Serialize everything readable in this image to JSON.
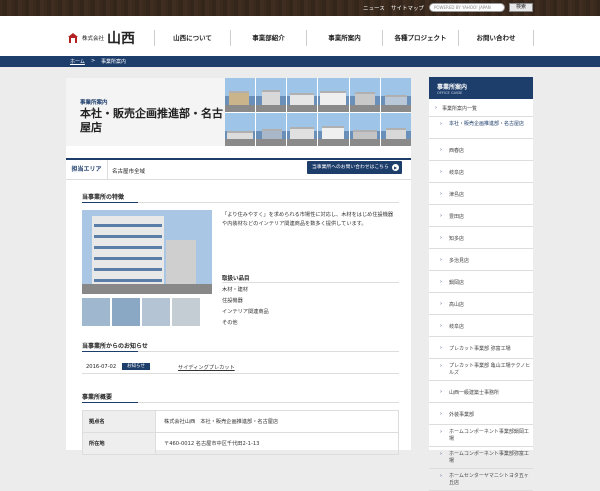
{
  "topbar": {
    "links": [
      "ニュース",
      "サイトマップ"
    ],
    "search_placeholder": "POWERED BY YAHOO! JAPAN",
    "search_button": "検索"
  },
  "header": {
    "logo_small": "株式会社",
    "logo_big": "山西",
    "nav": [
      "山西について",
      "事業部紹介",
      "事業所案内",
      "各種プロジェクト",
      "お問い合わせ"
    ]
  },
  "breadcrumb": [
    "ホーム",
    ">",
    "事業所案内"
  ],
  "hero": {
    "subtitle": "事業所案内",
    "title": "本社・販売企画推進部・名古屋店"
  },
  "area": {
    "label": "担当エリア",
    "value": "名古屋市全域",
    "inquiry_button": "当事業所へのお問い合わせはこちら"
  },
  "features": {
    "heading": "当事業所の特徴",
    "description": "「より住みやすく」を求められる市場性に対応し、木材をはじめ住設機器や内装材などのインテリア関連商品を数多く提供しています。",
    "items_heading": "取扱い品目",
    "items": [
      "木材・建材",
      "住設機器",
      "インテリア関連商品",
      "その他"
    ]
  },
  "news": {
    "heading": "当事業所からのお知らせ",
    "entries": [
      {
        "date": "2016-07-02",
        "badge": "お知らせ",
        "title": "サイディングプレカット"
      }
    ]
  },
  "overview": {
    "heading": "事業所概要",
    "rows": [
      {
        "label": "拠点名",
        "value": "株式会社山西　本社・販売企画推進部・名古屋店"
      },
      {
        "label": "所在地",
        "value": "〒460-0012 名古屋市中区千代田2-1-13"
      }
    ]
  },
  "sidebar": {
    "title": "事業所案内",
    "title_en": "OFFICE GUIDE",
    "items": [
      "事業所案内一覧",
      "本社・販売企画推進部・名古屋店",
      "西春店",
      "岐阜店",
      "津島店",
      "豊田店",
      "知多店",
      "多治見店",
      "鍋岡店",
      "高山店",
      "岐阜店",
      "プレカット事業部 弥富工場",
      "プレカット事業部 亀山工場テクノヒルズ",
      "山西一級建築士事務所",
      "外装事業部",
      "ホームコンポーネント事業部鍋岡工場",
      "ホームコンポーネント事業部弥富工場",
      "ホームセンターヤマニシトヨタ五ヶ丘店"
    ]
  },
  "colors": {
    "brand": "#1d3d6b",
    "topbar": "#3a2a1e"
  }
}
